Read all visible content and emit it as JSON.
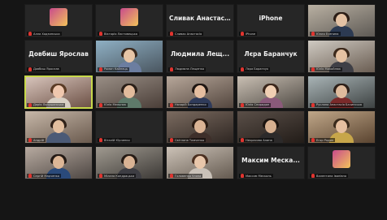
{
  "participants": [
    {
      "name": "Алла Ходзинська",
      "has_video": false,
      "has_avatar": true,
      "big_name": ""
    },
    {
      "name": "Вікторія Ластовецька",
      "has_video": false,
      "has_avatar": true,
      "big_name": ""
    },
    {
      "name": "Сливак Анастасія",
      "has_video": false,
      "has_avatar": false,
      "big_name": "Сливак Анастас..."
    },
    {
      "name": "iPhone",
      "has_video": false,
      "has_avatar": false,
      "big_name": "iPhone"
    },
    {
      "name": "Юлия Есенина",
      "has_video": true,
      "has_avatar": false,
      "big_name": ""
    },
    {
      "name": "Довбиш Ярослав",
      "has_video": false,
      "has_avatar": false,
      "big_name": "Довбиш Ярослав"
    },
    {
      "name": "Роман Кайнець",
      "has_video": true,
      "has_avatar": false,
      "big_name": ""
    },
    {
      "name": "Людмила Лещенко",
      "has_video": false,
      "has_avatar": false,
      "big_name": "Людмила Лещ..."
    },
    {
      "name": "Лєра Баранчук",
      "has_video": false,
      "has_avatar": false,
      "big_name": "Лєра Баранчук"
    },
    {
      "name": "Юлія Михайлюк",
      "has_video": true,
      "has_avatar": false,
      "big_name": ""
    },
    {
      "name": "Дарія Лопушанська",
      "has_video": true,
      "has_avatar": false,
      "big_name": "",
      "speaking": true
    },
    {
      "name": "Юлія Мельник",
      "has_video": true,
      "has_avatar": false,
      "big_name": ""
    },
    {
      "name": "Назарій Бондаренко",
      "has_video": true,
      "has_avatar": false,
      "big_name": ""
    },
    {
      "name": "Юлія Спиридон",
      "has_video": true,
      "has_avatar": false,
      "big_name": ""
    },
    {
      "name": "Руслана Анастасія Бачинська",
      "has_video": true,
      "has_avatar": false,
      "big_name": ""
    },
    {
      "name": "Андрій",
      "has_video": true,
      "has_avatar": false,
      "big_name": ""
    },
    {
      "name": "Віталій Юрченко",
      "has_video": false,
      "has_avatar": false,
      "big_name": ""
    },
    {
      "name": "Світлана Тимченко",
      "has_video": true,
      "has_avatar": false,
      "big_name": ""
    },
    {
      "name": "Некрасова Алина",
      "has_video": true,
      "has_avatar": false,
      "big_name": ""
    },
    {
      "name": "Егор Родин",
      "has_video": true,
      "has_avatar": false,
      "big_name": ""
    },
    {
      "name": "Сергій Марченко",
      "has_video": true,
      "has_avatar": false,
      "big_name": ""
    },
    {
      "name": "Мілана Кондрацька",
      "has_video": true,
      "has_avatar": false,
      "big_name": ""
    },
    {
      "name": "Головенко Уляна",
      "has_video": true,
      "has_avatar": false,
      "big_name": ""
    },
    {
      "name": "Максим Мескаль",
      "has_video": false,
      "has_avatar": false,
      "big_name": "Максим Меска..."
    },
    {
      "name": "Валентина Іванівна",
      "has_video": false,
      "has_avatar": true,
      "big_name": ""
    }
  ],
  "tile_colors": {
    "4": [
      "#b9b0a2",
      "#5e5a55"
    ],
    "6": [
      "#8fb0c4",
      "#4a5660"
    ],
    "9": [
      "#cfcac2",
      "#6a5d52"
    ],
    "10": [
      "#d9c6bd",
      "#6b4f44"
    ],
    "11": [
      "#9a8f86",
      "#4a3e38"
    ],
    "12": [
      "#b7a79a",
      "#53463e"
    ],
    "13": [
      "#c9bfb3",
      "#4f4a44"
    ],
    "14": [
      "#a9b4b6",
      "#3d4242"
    ],
    "15": [
      "#c6b7a8",
      "#6a5a4e"
    ],
    "17": [
      "#7b6b60",
      "#2e2622"
    ],
    "18": [
      "#5a4f48",
      "#221c18"
    ],
    "19": [
      "#c0a789",
      "#5a4430"
    ],
    "20": [
      "#b7aaa0",
      "#4e4743"
    ],
    "21": [
      "#a09a90",
      "#3c3936"
    ],
    "22": [
      "#ccc2b7",
      "#645a50"
    ]
  },
  "person_colors": {
    "4": [
      "#e4c2a4",
      "#2b1d16",
      "#2c3a52"
    ],
    "6": [
      "#e7c5a6",
      "#3a2a1f",
      "#6c7ea0"
    ],
    "9": [
      "#e6c2a2",
      "#3d2a1c",
      "#3f3f46"
    ],
    "10": [
      "#efc7ae",
      "#5a3b25",
      "#d8cfc4"
    ],
    "11": [
      "#e2bb9c",
      "#2a1f18",
      "#5e7a6a"
    ],
    "12": [
      "#e5bea0",
      "#1e1612",
      "#2f3b5a"
    ],
    "13": [
      "#f0cfb3",
      "#3a261b",
      "#8a5a7a"
    ],
    "14": [
      "#dfbb9d",
      "#2c1f18",
      "#7a2a2a"
    ],
    "15": [
      "#e3bf9f",
      "#302219",
      "#4b5a76"
    ],
    "17": [
      "#dab394",
      "#2a1b13",
      "#3e2f2a"
    ],
    "18": [
      "#d6b090",
      "#1b1410",
      "#2c2a2a"
    ],
    "19": [
      "#e5bfa0",
      "#3a2a1c",
      "#c7a64a"
    ],
    "20": [
      "#dcb696",
      "#231a15",
      "#2a4a7a"
    ],
    "21": [
      "#d9b394",
      "#251b15",
      "#3d3d43"
    ],
    "22": [
      "#e8c6aa",
      "#4a2f20",
      "#c9c1b8"
    ]
  }
}
